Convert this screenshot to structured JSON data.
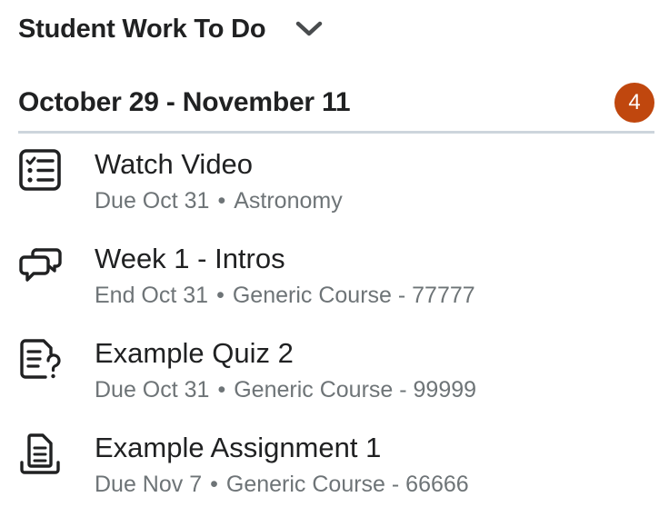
{
  "widget": {
    "title": "Student Work To Do",
    "collapse_icon": "chevron-down-icon"
  },
  "range": {
    "label": "October 29 - November 11",
    "count": "4",
    "badge_color": "#c0470e"
  },
  "items": [
    {
      "icon": "checklist-icon",
      "title": "Watch Video",
      "date": "Due Oct 31",
      "separator": "•",
      "course": "Astronomy"
    },
    {
      "icon": "discussion-icon",
      "title": "Week 1 - Intros",
      "date": "End Oct 31",
      "separator": "•",
      "course": "Generic Course - 77777"
    },
    {
      "icon": "quiz-icon",
      "title": "Example Quiz 2",
      "date": "Due Oct 31",
      "separator": "•",
      "course": "Generic Course - 99999"
    },
    {
      "icon": "assignment-icon",
      "title": "Example Assignment 1",
      "date": "Due Nov 7",
      "separator": "•",
      "course": "Generic Course - 66666"
    }
  ]
}
